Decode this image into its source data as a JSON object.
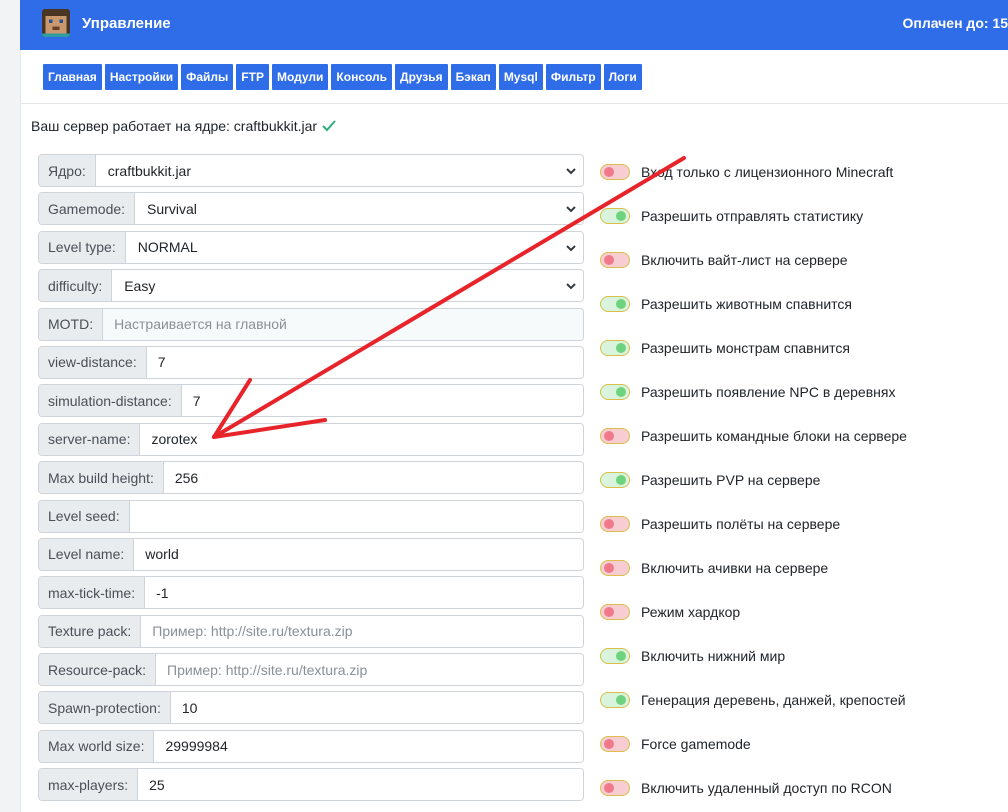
{
  "header": {
    "title": "Управление",
    "paid_until": "Оплачен до: 15"
  },
  "tabs": [
    "Главная",
    "Настройки",
    "Файлы",
    "FTP",
    "Модули",
    "Консоль",
    "Друзья",
    "Бэкап",
    "Mysql",
    "Фильтр",
    "Логи"
  ],
  "status": {
    "text": "Ваш сервер работает на ядре: craftbukkit.jar"
  },
  "fields": [
    {
      "label": "Ядро:",
      "value": "craftbukkit.jar",
      "type": "select"
    },
    {
      "label": "Gamemode:",
      "value": "Survival",
      "type": "select"
    },
    {
      "label": "Level type:",
      "value": "NORMAL",
      "type": "select"
    },
    {
      "label": "difficulty:",
      "value": "Easy",
      "type": "select"
    },
    {
      "label": "MOTD:",
      "value": "",
      "placeholder": "Настраивается на главной",
      "type": "readonly"
    },
    {
      "label": "view-distance:",
      "value": "7",
      "type": "input"
    },
    {
      "label": "simulation-distance:",
      "value": "7",
      "type": "input"
    },
    {
      "label": "server-name:",
      "value": "zorotex",
      "type": "input"
    },
    {
      "label": "Max build height:",
      "value": "256",
      "type": "input"
    },
    {
      "label": "Level seed:",
      "value": "",
      "type": "input"
    },
    {
      "label": "Level name:",
      "value": "world",
      "type": "input"
    },
    {
      "label": "max-tick-time:",
      "value": "-1",
      "type": "input"
    },
    {
      "label": "Texture pack:",
      "value": "",
      "placeholder": "Пример: http://site.ru/textura.zip",
      "type": "input"
    },
    {
      "label": "Resource-pack:",
      "value": "",
      "placeholder": "Пример: http://site.ru/textura.zip",
      "type": "input"
    },
    {
      "label": "Spawn-protection:",
      "value": "10",
      "type": "input"
    },
    {
      "label": "Max world size:",
      "value": "29999984",
      "type": "input"
    },
    {
      "label": "max-players:",
      "value": "25",
      "type": "input"
    }
  ],
  "toggles": [
    {
      "label": "Вход только с лицензионного Minecraft",
      "on": false
    },
    {
      "label": "Разрешить отправлять статистику",
      "on": true
    },
    {
      "label": "Включить вайт-лист на сервере",
      "on": false
    },
    {
      "label": "Разрешить животным спавнится",
      "on": true
    },
    {
      "label": "Разрешить монстрам спавнится",
      "on": true
    },
    {
      "label": "Разрешить появление NPC в деревнях",
      "on": true
    },
    {
      "label": "Разрешить командные блоки на сервере",
      "on": false
    },
    {
      "label": "Разрешить PVP на сервере",
      "on": true
    },
    {
      "label": "Разрешить полёты на сервере",
      "on": false
    },
    {
      "label": "Включить ачивки на сервере",
      "on": false
    },
    {
      "label": "Режим хардкор",
      "on": false
    },
    {
      "label": "Включить нижний мир",
      "on": true
    },
    {
      "label": "Генерация деревень, данжей, крепостей",
      "on": true
    },
    {
      "label": "Force gamemode",
      "on": false
    },
    {
      "label": "Включить удаленный доступ по RCON",
      "on": false
    }
  ],
  "colors": {
    "accent": "#2f6de8",
    "toggle_on": "#6fd27f",
    "toggle_off": "#f07a8c",
    "annotation_arrow": "#e8242b"
  }
}
